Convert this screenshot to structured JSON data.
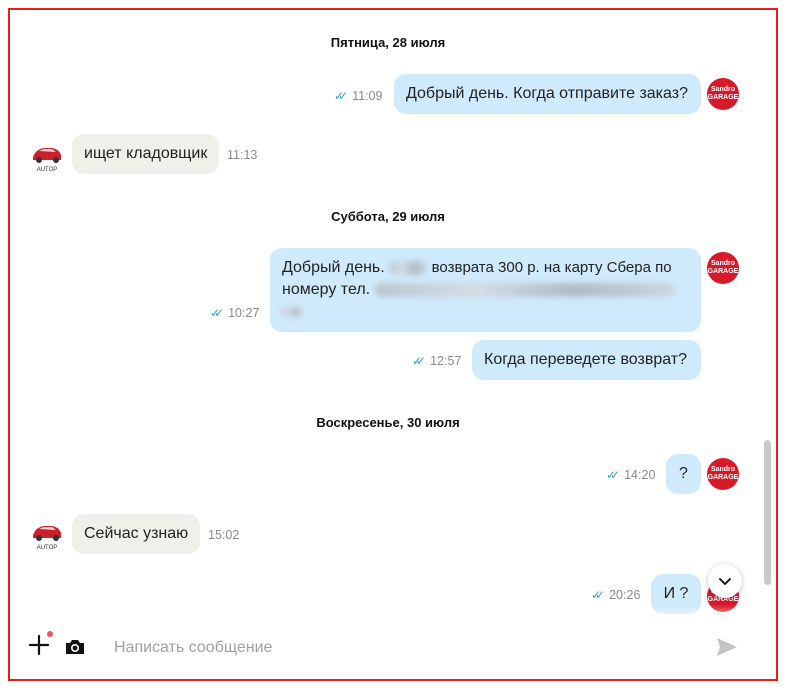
{
  "dates": [
    "Пятница, 28 июля",
    "Суббота, 29 июля",
    "Воскресенье, 30 июля"
  ],
  "messages": [
    {
      "text": "Добрый день. Когда отправите заказ?",
      "time": "11:09",
      "direction": "out"
    },
    {
      "text": "ищет кладовщик",
      "time": "11:13",
      "direction": "in"
    },
    {
      "line1": "Добрый день.",
      "line2": "номеру тел.",
      "visible_mid": "возврата 300 р. на карту Сбера по",
      "time": "10:27",
      "direction": "out"
    },
    {
      "text": "Когда переведете возврат?",
      "time": "12:57",
      "direction": "out"
    },
    {
      "text": "?",
      "time": "14:20",
      "direction": "out"
    },
    {
      "text": "Сейчас узнаю",
      "time": "15:02",
      "direction": "in"
    },
    {
      "text": "И ?",
      "time": "20:26",
      "direction": "out"
    }
  ],
  "avatars": {
    "seller_top": "Sandro",
    "seller_bottom": "GARAGE",
    "shop": "AUTOP"
  },
  "composer": {
    "placeholder": "Написать сообщение"
  },
  "colors": {
    "outgoing_bubble": "#cfeafb",
    "incoming_bubble": "#f1efea",
    "accent": "#2f9ad8",
    "avatar_red": "#d71a2a",
    "frame": "#e0201b"
  }
}
